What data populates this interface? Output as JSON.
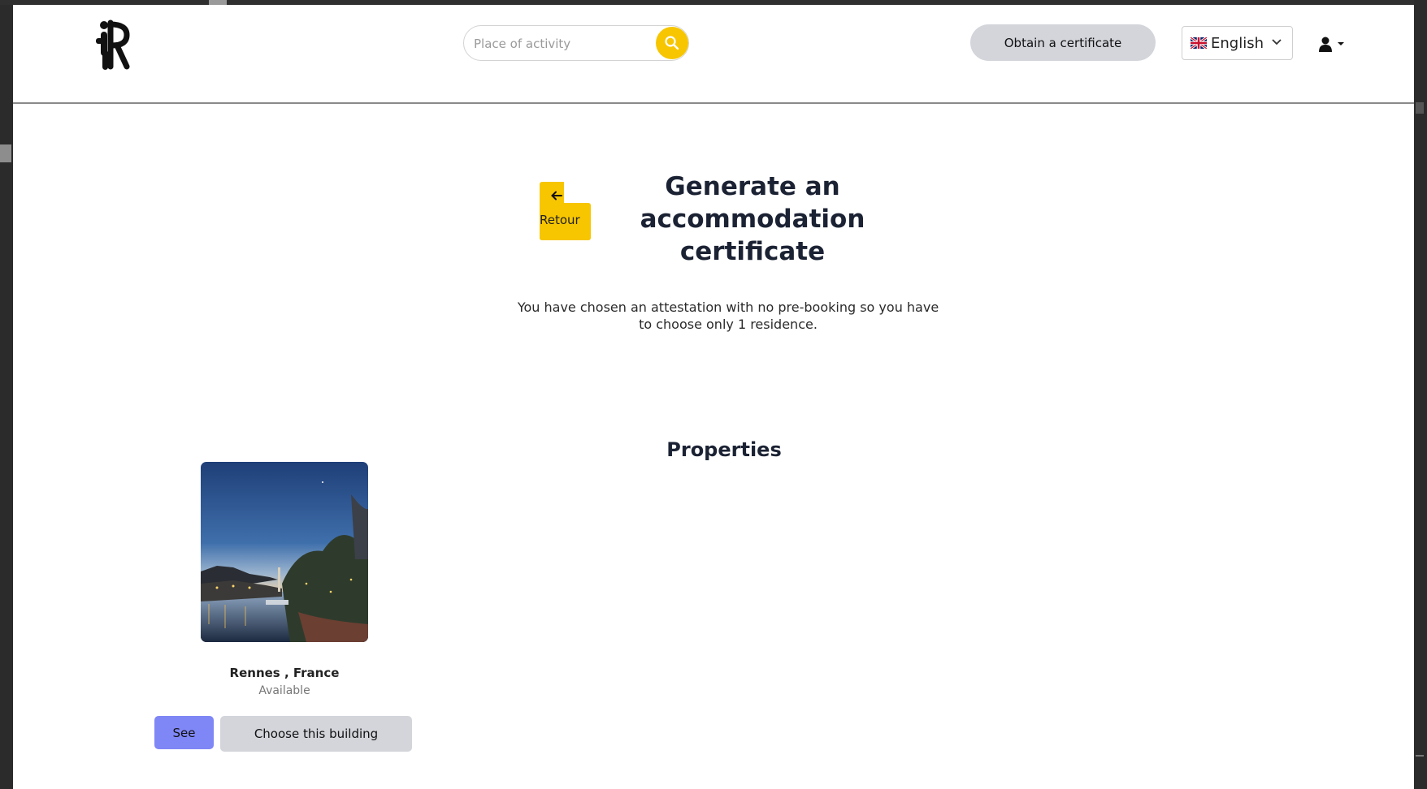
{
  "navbar": {
    "logo_alt": "iR",
    "search": {
      "placeholder": "Place of activity",
      "value": ""
    },
    "certificate_button": "Obtain a certificate",
    "language": {
      "selected": "English",
      "flag": "gb-flag-icon"
    },
    "user_menu_icon": "user-icon"
  },
  "back_button": {
    "label": "Retour",
    "icon": "arrow-left-icon"
  },
  "main": {
    "title": "Generate an accommodation certificate",
    "info": "You have chosen an attestation with no pre-booking so you have to choose only 1 residence.",
    "section_title": "Properties"
  },
  "properties": [
    {
      "location": "Rennes , France",
      "status": "Available",
      "see_label": "See",
      "choose_label": "Choose this building"
    }
  ],
  "colors": {
    "accent_yellow": "#f7c600",
    "see_button": "#7f86f6",
    "secondary_button": "#d3d5db",
    "heading": "#1b2233"
  }
}
